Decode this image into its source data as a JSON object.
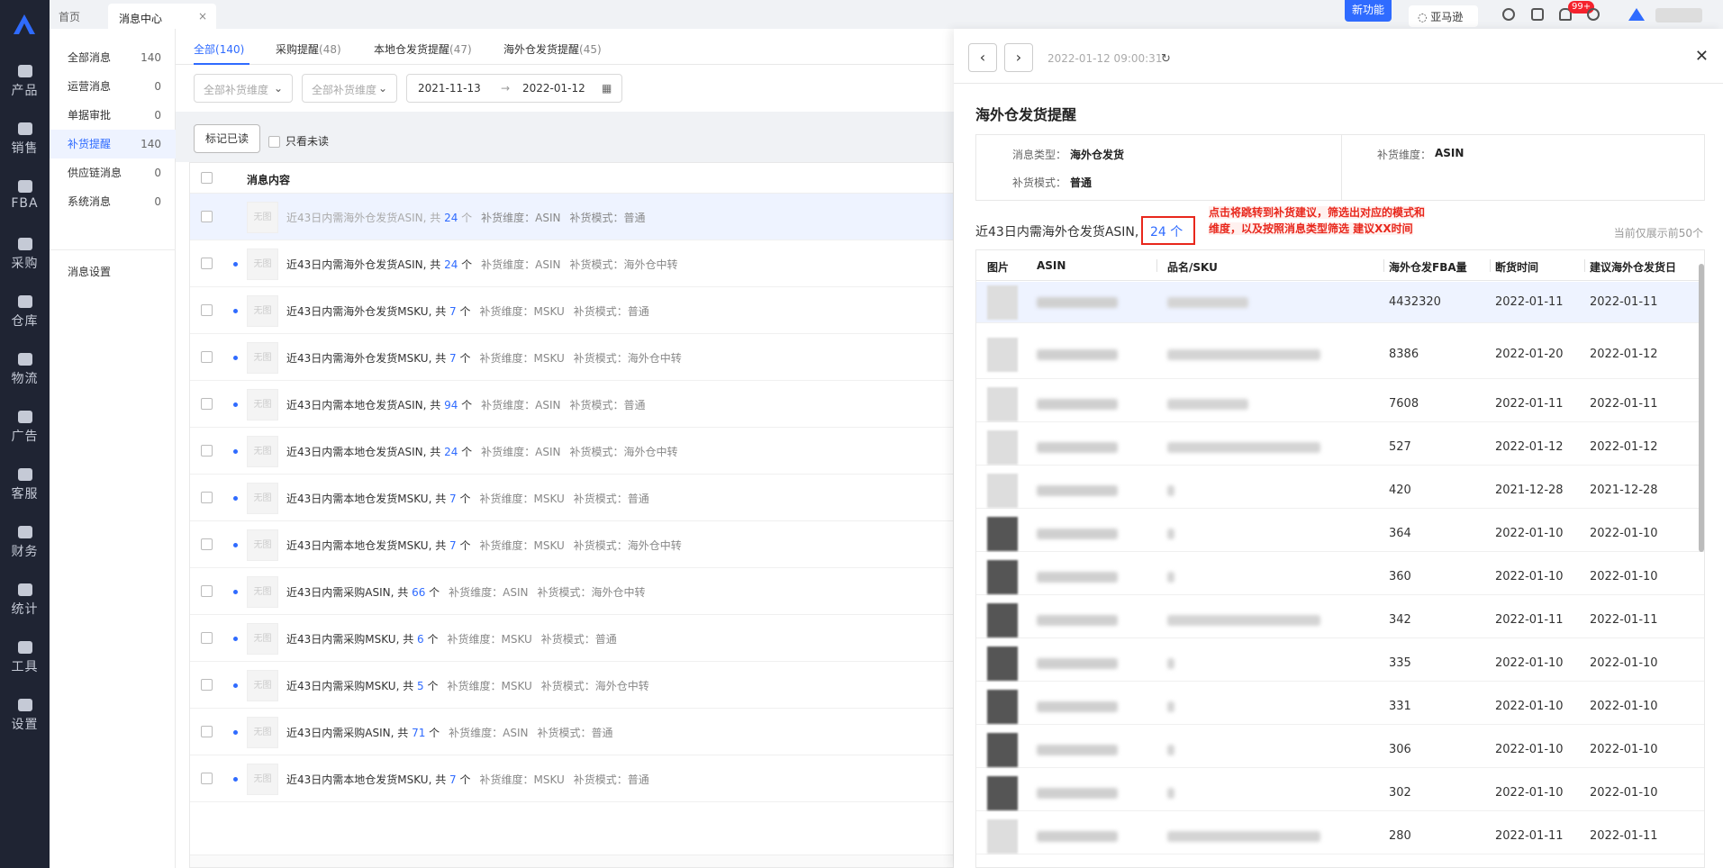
{
  "nav": {
    "items": [
      {
        "label": "产品",
        "icon": "box-icon"
      },
      {
        "label": "销售",
        "icon": "sell-icon"
      },
      {
        "label": "FBA",
        "icon": "fba-icon"
      },
      {
        "label": "采购",
        "icon": "cart-icon"
      },
      {
        "label": "仓库",
        "icon": "warehouse-icon"
      },
      {
        "label": "物流",
        "icon": "truck-icon"
      },
      {
        "label": "广告",
        "icon": "ad-icon"
      },
      {
        "label": "客服",
        "icon": "mail-icon"
      },
      {
        "label": "财务",
        "icon": "finance-icon"
      },
      {
        "label": "统计",
        "icon": "pie-icon"
      },
      {
        "label": "工具",
        "icon": "wrench-icon"
      },
      {
        "label": "设置",
        "icon": "gear-icon"
      }
    ]
  },
  "topbar": {
    "home": "首页",
    "current_tab": "消息中心",
    "close": "×",
    "new_feature": "新功能",
    "store": "亚马逊",
    "badge": "99+"
  },
  "sidebar": {
    "items": [
      {
        "label": "全部消息",
        "count": "140"
      },
      {
        "label": "运营消息",
        "count": "0"
      },
      {
        "label": "单据审批",
        "count": "0"
      },
      {
        "label": "补货提醒",
        "count": "140"
      },
      {
        "label": "供应链消息",
        "count": "0"
      },
      {
        "label": "系统消息",
        "count": "0"
      }
    ],
    "settings": "消息设置"
  },
  "main": {
    "tabs": [
      {
        "label": "全部",
        "count": "(140)"
      },
      {
        "label": "采购提醒",
        "count": "(48)"
      },
      {
        "label": "本地仓发货提醒",
        "count": "(47)"
      },
      {
        "label": "海外仓发货提醒",
        "count": "(45)"
      }
    ],
    "filter1": "全部补货维度",
    "filter2": "全部补货维度",
    "date_start": "2021-11-13",
    "date_arrow": "→",
    "date_end": "2022-01-12",
    "mark_read": "标记已读",
    "unread_only": "只看未读",
    "column": "消息内容",
    "thumb": "无图",
    "rows": [
      {
        "pre": "近43日内需海外仓发货ASIN, 共 ",
        "num": "24",
        "suf": " 个",
        "dim": "补货维度：ASIN",
        "mode": "补货模式：普通"
      },
      {
        "pre": "近43日内需海外仓发货ASIN, 共 ",
        "num": "24",
        "suf": " 个",
        "dim": "补货维度：ASIN",
        "mode": "补货模式：海外仓中转"
      },
      {
        "pre": "近43日内需海外仓发货MSKU, 共 ",
        "num": "7",
        "suf": " 个",
        "dim": "补货维度：MSKU",
        "mode": "补货模式：普通"
      },
      {
        "pre": "近43日内需海外仓发货MSKU, 共 ",
        "num": "7",
        "suf": " 个",
        "dim": "补货维度：MSKU",
        "mode": "补货模式：海外仓中转"
      },
      {
        "pre": "近43日内需本地仓发货ASIN, 共 ",
        "num": "94",
        "suf": " 个",
        "dim": "补货维度：ASIN",
        "mode": "补货模式：普通"
      },
      {
        "pre": "近43日内需本地仓发货ASIN, 共 ",
        "num": "24",
        "suf": " 个",
        "dim": "补货维度：ASIN",
        "mode": "补货模式：海外仓中转"
      },
      {
        "pre": "近43日内需本地仓发货MSKU, 共 ",
        "num": "7",
        "suf": " 个",
        "dim": "补货维度：MSKU",
        "mode": "补货模式：普通"
      },
      {
        "pre": "近43日内需本地仓发货MSKU, 共 ",
        "num": "7",
        "suf": " 个",
        "dim": "补货维度：MSKU",
        "mode": "补货模式：海外仓中转"
      },
      {
        "pre": "近43日内需采购ASIN, 共 ",
        "num": "66",
        "suf": " 个",
        "dim": "补货维度：ASIN",
        "mode": "补货模式：海外仓中转"
      },
      {
        "pre": "近43日内需采购MSKU, 共 ",
        "num": "6",
        "suf": " 个",
        "dim": "补货维度：MSKU",
        "mode": "补货模式：普通"
      },
      {
        "pre": "近43日内需采购MSKU, 共 ",
        "num": "5",
        "suf": " 个",
        "dim": "补货维度：MSKU",
        "mode": "补货模式：海外仓中转"
      },
      {
        "pre": "近43日内需采购ASIN, 共 ",
        "num": "71",
        "suf": " 个",
        "dim": "补货维度：ASIN",
        "mode": "补货模式：普通"
      },
      {
        "pre": "近43日内需本地仓发货MSKU, 共 ",
        "num": "7",
        "suf": " 个",
        "dim": "补货维度：MSKU",
        "mode": "补货模式：普通"
      }
    ]
  },
  "drawer": {
    "prev": "‹",
    "next": "›",
    "time": "2022-01-12 09:00:31",
    "refresh": "↻",
    "close": "✕",
    "title": "海外仓发货提醒",
    "type_label": "消息类型：",
    "type_value": "海外仓发货",
    "mode_label": "补货模式：",
    "mode_value": "普通",
    "dim_label": "补货维度：",
    "dim_value": "ASIN",
    "summary": "近43日内需海外仓发货ASIN,",
    "summary_num": "24 个",
    "annotation_line1": "点击将跳转到补货建议，筛选出对应的模式和",
    "annotation_line2": "维度，以及按照消息类型筛选 建议XX时间",
    "showing": "当前仅展示前50个",
    "headers": {
      "pic": "图片",
      "asin": "ASIN",
      "sku": "品名/SKU",
      "qty": "海外仓发FBA量",
      "outdate": "断货时间",
      "shipdate": "建议海外仓发货日"
    },
    "rows": [
      {
        "qty": "4432320",
        "out": "2022-01-11",
        "ship": "2022-01-11"
      },
      {
        "qty": "8386",
        "out": "2022-01-20",
        "ship": "2022-01-12"
      },
      {
        "qty": "7608",
        "out": "2022-01-11",
        "ship": "2022-01-11"
      },
      {
        "qty": "527",
        "out": "2022-01-12",
        "ship": "2022-01-12"
      },
      {
        "qty": "420",
        "out": "2021-12-28",
        "ship": "2021-12-28"
      },
      {
        "qty": "364",
        "out": "2022-01-10",
        "ship": "2022-01-10"
      },
      {
        "qty": "360",
        "out": "2022-01-10",
        "ship": "2022-01-10"
      },
      {
        "qty": "342",
        "out": "2022-01-11",
        "ship": "2022-01-11"
      },
      {
        "qty": "335",
        "out": "2022-01-10",
        "ship": "2022-01-10"
      },
      {
        "qty": "331",
        "out": "2022-01-10",
        "ship": "2022-01-10"
      },
      {
        "qty": "306",
        "out": "2022-01-10",
        "ship": "2022-01-10"
      },
      {
        "qty": "302",
        "out": "2022-01-10",
        "ship": "2022-01-10"
      },
      {
        "qty": "280",
        "out": "2022-01-11",
        "ship": "2022-01-11"
      }
    ]
  }
}
